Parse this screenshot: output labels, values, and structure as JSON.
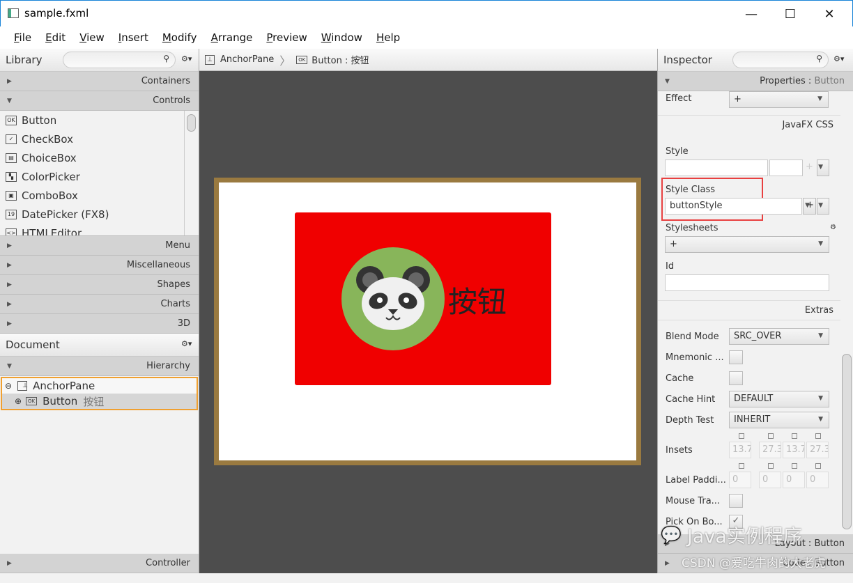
{
  "window": {
    "title": "sample.fxml"
  },
  "menu": [
    "File",
    "Edit",
    "View",
    "Insert",
    "Modify",
    "Arrange",
    "Preview",
    "Window",
    "Help"
  ],
  "library": {
    "title": "Library",
    "sections": {
      "containers": "Containers",
      "controls": "Controls",
      "menu": "Menu",
      "misc": "Miscellaneous",
      "shapes": "Shapes",
      "charts": "Charts",
      "d3": "3D"
    },
    "controls": [
      {
        "icon": "OK",
        "label": "Button"
      },
      {
        "icon": "✓",
        "label": "CheckBox"
      },
      {
        "icon": "▤",
        "label": "ChoiceBox"
      },
      {
        "icon": "▚",
        "label": "ColorPicker"
      },
      {
        "icon": "▣",
        "label": "ComboBox"
      },
      {
        "icon": "19",
        "label": "DatePicker  (FX8)"
      },
      {
        "icon": "<>",
        "label": "HTMLEditor"
      }
    ]
  },
  "document": {
    "title": "Document",
    "hierarchy": "Hierarchy",
    "tree": [
      {
        "label": "AnchorPane",
        "sub": ""
      },
      {
        "label": "Button",
        "sub": "按钮"
      }
    ],
    "controller": "Controller"
  },
  "breadcrumb": [
    {
      "icon": "⊥",
      "label": "AnchorPane"
    },
    {
      "icon": "OK",
      "label": "Button : 按钮"
    }
  ],
  "canvas": {
    "button_text": "按钮",
    "button_color": "#f00000",
    "panda_bg": "#88b55a",
    "pane_border": "#9a7a40"
  },
  "inspector": {
    "title": "Inspector",
    "properties": "Properties",
    "properties_target": "Button",
    "effect_label": "Effect",
    "effect_value": "+",
    "javafx_css": "JavaFX CSS",
    "style_label": "Style",
    "style_class_label": "Style Class",
    "style_class_value": "buttonStyle",
    "stylesheets_label": "Stylesheets",
    "stylesheets_value": "+",
    "id_label": "Id",
    "extras": "Extras",
    "blend_mode_label": "Blend Mode",
    "blend_mode": "SRC_OVER",
    "mnemonic_label": "Mnemonic ...",
    "cache_label": "Cache",
    "cache_hint_label": "Cache Hint",
    "cache_hint": "DEFAULT",
    "depth_test_label": "Depth Test",
    "depth_test": "INHERIT",
    "insets_label": "Insets",
    "insets": [
      "13.7",
      "27.3",
      "13.7",
      "27.3"
    ],
    "label_padding_label": "Label Paddi...",
    "label_padding": [
      "0",
      "0",
      "0",
      "0"
    ],
    "mouse_transparent_label": "Mouse Tra...",
    "pick_on_bounds_label": "Pick On Bo...",
    "pick_on_bounds": true,
    "layout_section": "Layout : Button",
    "code_section": "Code : Button"
  },
  "watermark": {
    "line1": "Java实例程序",
    "line2": "CSDN @爱吃牛肉的大老虎"
  }
}
